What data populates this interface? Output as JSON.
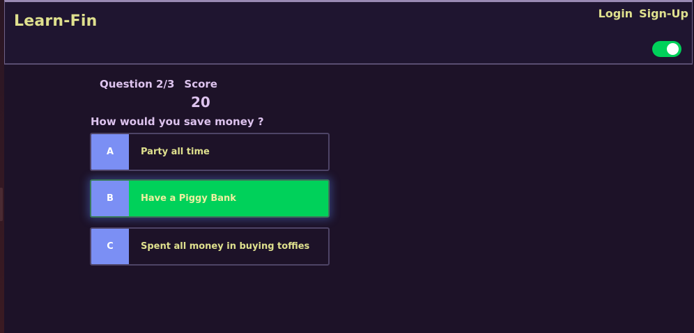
{
  "header": {
    "brand": "Learn-Fin",
    "login_label": "Login",
    "signup_label": "Sign-Up",
    "theme_toggle_on": true
  },
  "quiz": {
    "question_counter": "Question 2/3",
    "score_label": "Score",
    "score_value": "20",
    "question": "How would you save money ?",
    "options": [
      {
        "letter": "A",
        "text": "Party all time",
        "selected": false
      },
      {
        "letter": "B",
        "text": "Have a Piggy Bank",
        "selected": true
      },
      {
        "letter": "C",
        "text": "Spent all money in buying toffies",
        "selected": false
      }
    ]
  },
  "colors": {
    "background": "#1d1228",
    "accent_yellow": "#dfe08e",
    "selected_green": "#00d15a",
    "option_letter_blue": "#7b8ff4",
    "text_lavender": "#ddc3ee"
  }
}
